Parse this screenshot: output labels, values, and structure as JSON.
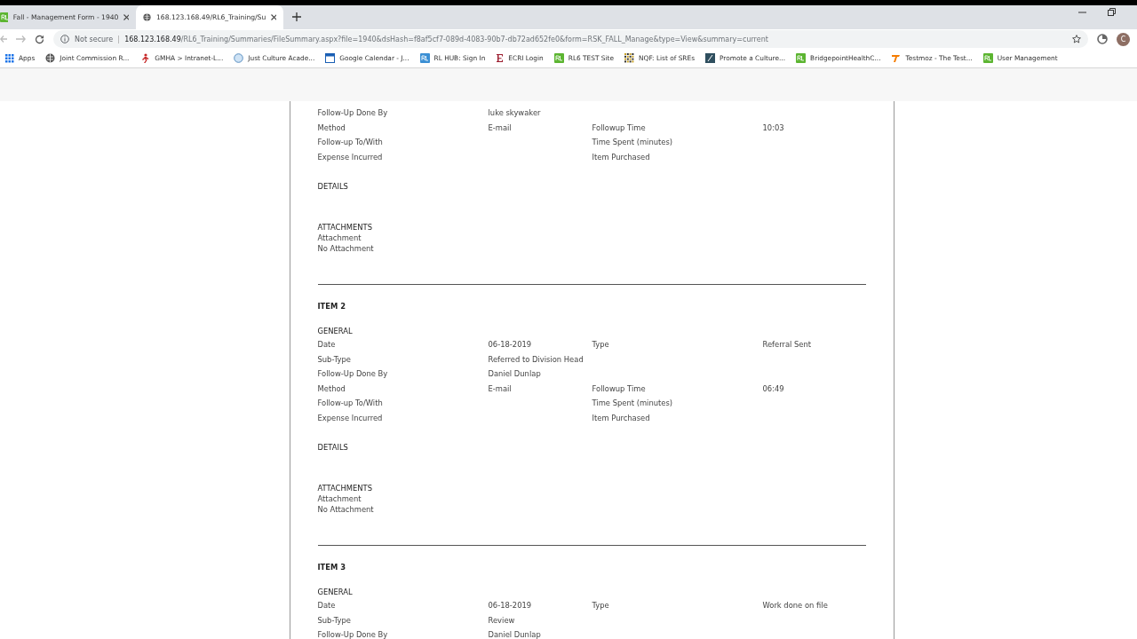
{
  "browser": {
    "tabs": [
      {
        "title": "Fall - Management Form - 1940",
        "kind": "rl",
        "selected": false
      },
      {
        "title": "168.123.168.49/RL6_Training/Su",
        "kind": "globe",
        "selected": true
      }
    ],
    "security": "Not secure",
    "url_host": "168.123.168.49",
    "url_path": "/RL6_Training/Summaries/FileSummary.aspx?file=1940&dsHash=f8af5cf7-089d-4083-90b7-db72ad652fe0&form=RSK_FALL_Manage&type=View&summary=current",
    "profile_initial": "C"
  },
  "bookmarks": [
    {
      "label": "Apps",
      "kind": "apps"
    },
    {
      "label": "Joint Commission R...",
      "kind": "globe"
    },
    {
      "label": "GMHA > Intranet-L...",
      "kind": "figure"
    },
    {
      "label": "Just Culture Acade...",
      "kind": "circle"
    },
    {
      "label": "Google Calendar - J...",
      "kind": "calendar"
    },
    {
      "label": "RL HUB: Sign In",
      "kind": "rlblue"
    },
    {
      "label": "ECRI Login",
      "kind": "ecri"
    },
    {
      "label": "RL6 TEST Site",
      "kind": "rl"
    },
    {
      "label": "NQF: List of SREs",
      "kind": "grid"
    },
    {
      "label": "Promote a Culture...",
      "kind": "pa"
    },
    {
      "label": "BridgepointHealthC...",
      "kind": "rl"
    },
    {
      "label": "Testmoz - The Test...",
      "kind": "testmoz"
    },
    {
      "label": "User Management",
      "kind": "rl"
    }
  ],
  "report": {
    "items": [
      {
        "rows": [
          {
            "label": "Follow-Up Done By",
            "value": "luke skywaker"
          },
          {
            "label": "Method",
            "value": "E-mail",
            "label_2": "Followup Time",
            "value_2": "10:03"
          },
          {
            "label": "Follow-up To/With",
            "label_2": "Time Spent (minutes)"
          },
          {
            "label": "Expense Incurred",
            "label_2": "Item Purchased"
          }
        ],
        "details_label": "DETAILS",
        "attachments_label": "ATTACHMENTS",
        "attachment_label": "Attachment",
        "attachment_value": "No Attachment"
      },
      {
        "title": "ITEM 2",
        "section": "GENERAL",
        "rows": [
          {
            "label": "Date",
            "value": "06-18-2019",
            "label_2": "Type",
            "value_2": "Referral Sent"
          },
          {
            "label": "Sub-Type",
            "value": "Referred to Division Head"
          },
          {
            "label": "Follow-Up Done By",
            "value": "Daniel Dunlap"
          },
          {
            "label": "Method",
            "value": "E-mail",
            "label_2": "Followup Time",
            "value_2": "06:49"
          },
          {
            "label": "Follow-up To/With",
            "label_2": "Time Spent (minutes)"
          },
          {
            "label": "Expense Incurred",
            "label_2": "Item Purchased"
          }
        ],
        "details_label": "DETAILS",
        "attachments_label": "ATTACHMENTS",
        "attachment_label": "Attachment",
        "attachment_value": "No Attachment"
      },
      {
        "title": "ITEM 3",
        "section": "GENERAL",
        "rows": [
          {
            "label": "Date",
            "value": "06-18-2019",
            "label_2": "Type",
            "value_2": "Work done on file"
          },
          {
            "label": "Sub-Type",
            "value": "Review"
          },
          {
            "label": "Follow-Up Done By",
            "value": "Daniel Dunlap"
          }
        ]
      }
    ]
  }
}
